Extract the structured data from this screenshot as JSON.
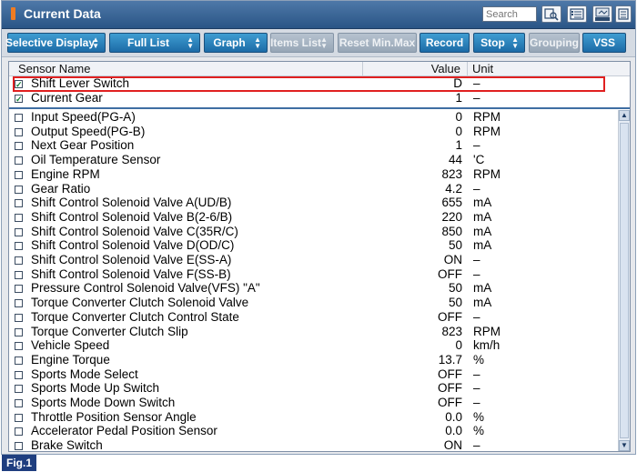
{
  "window": {
    "title": "Current Data",
    "search_placeholder": "Search"
  },
  "toolbar": {
    "buttons": [
      {
        "label": "Selective Display"
      },
      {
        "label": "Full List"
      },
      {
        "label": "Graph"
      },
      {
        "label": "Items List"
      },
      {
        "label": "Reset Min.Max"
      },
      {
        "label": "Record"
      },
      {
        "label": "Stop"
      },
      {
        "label": "Grouping"
      },
      {
        "label": "VSS"
      }
    ]
  },
  "table": {
    "headers": {
      "name": "Sensor Name",
      "value": "Value",
      "unit": "Unit"
    },
    "pinned_rows": [
      {
        "name": "Shift Lever Switch",
        "value": "D",
        "unit": "–",
        "checked": true
      },
      {
        "name": "Current Gear",
        "value": "1",
        "unit": "–",
        "checked": true
      }
    ],
    "rows": [
      {
        "name": "Input Speed(PG-A)",
        "value": "0",
        "unit": "RPM"
      },
      {
        "name": "Output Speed(PG-B)",
        "value": "0",
        "unit": "RPM"
      },
      {
        "name": "Next Gear Position",
        "value": "1",
        "unit": "–"
      },
      {
        "name": "Oil Temperature Sensor",
        "value": "44",
        "unit": "'C"
      },
      {
        "name": "Engine RPM",
        "value": "823",
        "unit": "RPM"
      },
      {
        "name": "Gear Ratio",
        "value": "4.2",
        "unit": "–"
      },
      {
        "name": "Shift Control Solenoid Valve A(UD/B)",
        "value": "655",
        "unit": "mA"
      },
      {
        "name": "Shift Control Solenoid Valve B(2-6/B)",
        "value": "220",
        "unit": "mA"
      },
      {
        "name": "Shift Control Solenoid Valve C(35R/C)",
        "value": "850",
        "unit": "mA"
      },
      {
        "name": "Shift Control Solenoid Valve D(OD/C)",
        "value": "50",
        "unit": "mA"
      },
      {
        "name": "Shift Control Solenoid Valve E(SS-A)",
        "value": "ON",
        "unit": "–"
      },
      {
        "name": "Shift Control Solenoid Valve F(SS-B)",
        "value": "OFF",
        "unit": "–"
      },
      {
        "name": "Pressure Control Solenoid Valve(VFS) \"A\"",
        "value": "50",
        "unit": "mA"
      },
      {
        "name": "Torque Converter Clutch Solenoid Valve",
        "value": "50",
        "unit": "mA"
      },
      {
        "name": "Torque Converter Clutch Control State",
        "value": "OFF",
        "unit": "–"
      },
      {
        "name": "Torque Converter Clutch Slip",
        "value": "823",
        "unit": "RPM"
      },
      {
        "name": "Vehicle Speed",
        "value": "0",
        "unit": "km/h"
      },
      {
        "name": "Engine Torque",
        "value": "13.7",
        "unit": "%"
      },
      {
        "name": "Sports Mode Select",
        "value": "OFF",
        "unit": "–"
      },
      {
        "name": "Sports Mode Up Switch",
        "value": "OFF",
        "unit": "–"
      },
      {
        "name": "Sports Mode Down Switch",
        "value": "OFF",
        "unit": "–"
      },
      {
        "name": "Throttle Position Sensor Angle",
        "value": "0.0",
        "unit": "%"
      },
      {
        "name": "Accelerator Pedal Position Sensor",
        "value": "0.0",
        "unit": "%"
      },
      {
        "name": "Brake Switch",
        "value": "ON",
        "unit": "–"
      }
    ]
  },
  "figure_label": "Fig.1",
  "colors": {
    "titlebar": "#2a5586",
    "button": "#1c6ba7",
    "highlight": "#e02020",
    "check": "#14843a"
  }
}
